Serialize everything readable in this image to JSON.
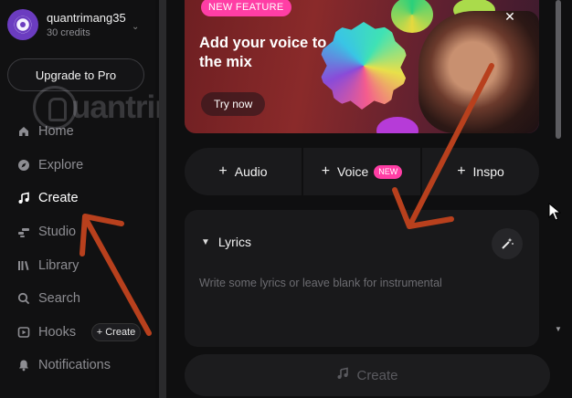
{
  "account": {
    "username": "quantrimang35",
    "credits": "30 credits"
  },
  "sidebar": {
    "upgrade_label": "Upgrade to Pro",
    "items": [
      {
        "label": "Home",
        "icon": "home-icon"
      },
      {
        "label": "Explore",
        "icon": "compass-icon"
      },
      {
        "label": "Create",
        "icon": "music-note-icon"
      },
      {
        "label": "Studio",
        "icon": "studio-icon"
      },
      {
        "label": "Library",
        "icon": "library-icon"
      },
      {
        "label": "Search",
        "icon": "search-icon"
      },
      {
        "label": "Hooks",
        "icon": "hooks-icon"
      },
      {
        "label": "Notifications",
        "icon": "bell-icon"
      }
    ],
    "hooks_create_label": "+ Create"
  },
  "watermark": {
    "text": "uantrimang"
  },
  "banner": {
    "badge": "NEW FEATURE",
    "headline": "Add your voice to the mix",
    "cta": "Try now",
    "close_icon": "close-icon"
  },
  "tabs": {
    "audio": "Audio",
    "voice": "Voice",
    "voice_badge": "NEW",
    "inspo": "Inspo"
  },
  "lyrics": {
    "label": "Lyrics",
    "placeholder": "Write some lyrics or leave blank for instrumental"
  },
  "create_button_label": "Create",
  "colors": {
    "accent_pink": "#ff3ea5",
    "annotation_arrow": "#b8401d",
    "background": "#0f0f10"
  }
}
